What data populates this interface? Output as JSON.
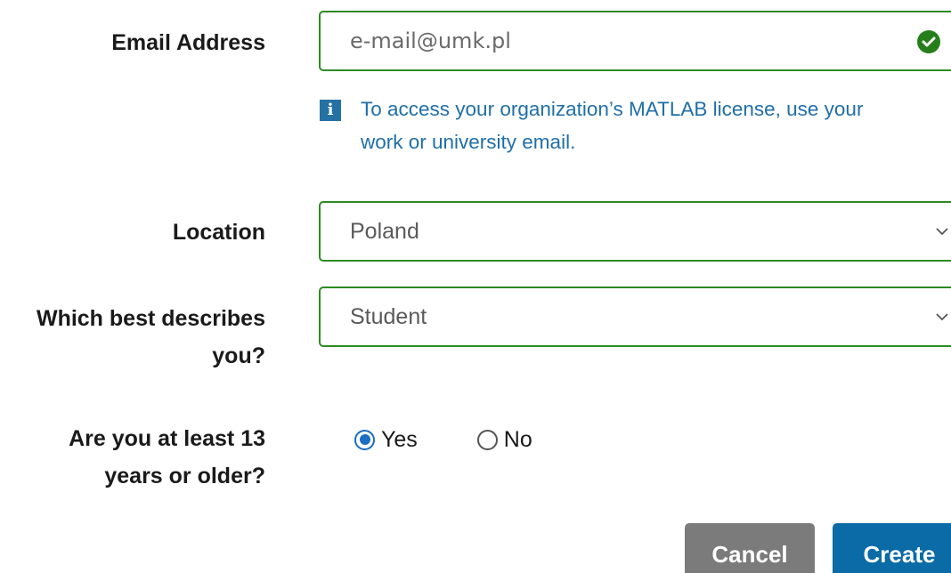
{
  "form": {
    "email": {
      "label": "Email Address",
      "value": "e-mail@umk.pl",
      "status_icon": "check-circle-icon",
      "status_color": "#267e1b",
      "info_icon": "info-icon",
      "info_text_line1": "To access your organization’s MATLAB license, use your",
      "info_text_line2": "work or university email."
    },
    "location": {
      "label": "Location",
      "value": "Poland"
    },
    "role": {
      "label_line1": "Which best describes",
      "label_line2": "you?",
      "value": "Student"
    },
    "age": {
      "label_line1": "Are you at least 13",
      "label_line2": "years or older?",
      "options": [
        {
          "label": "Yes",
          "selected": true
        },
        {
          "label": "No",
          "selected": false
        }
      ]
    },
    "buttons": {
      "cancel": "Cancel",
      "create": "Create"
    }
  },
  "colors": {
    "field_border": "#2e8b22",
    "info_text": "#1f6fa8",
    "radio_selected": "#1b6ec2",
    "cancel_bg": "#7b7b7b",
    "create_bg": "#0a6ba6"
  }
}
